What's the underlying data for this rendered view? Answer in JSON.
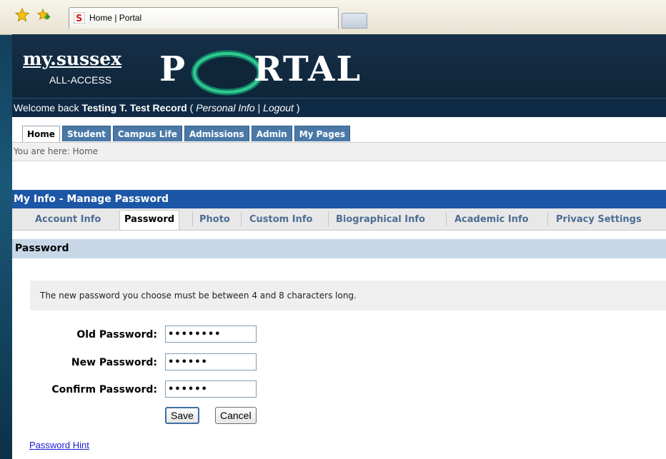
{
  "browser": {
    "tab_title": "Home | Portal"
  },
  "banner": {
    "logo_main": "my.sussex",
    "logo_sub": "ALL-ACCESS",
    "logo_p": "P",
    "logo_rtal": "RTAL"
  },
  "welcome": {
    "prefix": "Welcome back ",
    "user": "Testing T. Test Record",
    "open": " ( ",
    "personal_info": "Personal Info",
    "sep": " | ",
    "logout": "Logout",
    "close": " )"
  },
  "main_tabs": [
    "Home",
    "Student",
    "Campus Life",
    "Admissions",
    "Admin",
    "My Pages"
  ],
  "breadcrumb": "You are here:  Home",
  "section_title": "My Info - Manage Password",
  "sub_tabs": [
    "Account Info",
    "Password",
    "Photo",
    "Custom Info",
    "Biographical Info",
    "Academic Info",
    "Privacy Settings"
  ],
  "password_header": "Password",
  "info_text": "The new password you choose must be between 4 and 8 characters long.",
  "form": {
    "old_label": "Old Password:",
    "old_value": "••••••••",
    "new_label": "New Password:",
    "new_value": "••••••",
    "confirm_label": "Confirm Password:",
    "confirm_value": "••••••",
    "save": "Save",
    "cancel": "Cancel"
  },
  "hint_link": "Password Hint"
}
